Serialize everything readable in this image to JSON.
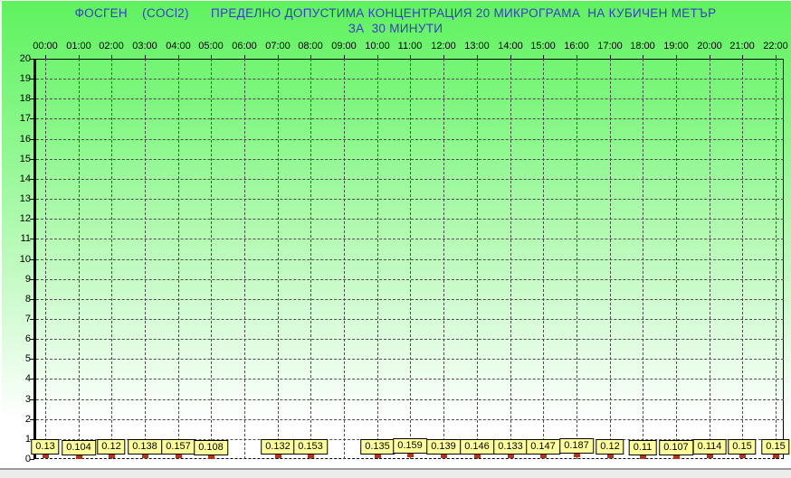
{
  "colors": {
    "background_top": "#5ef25e",
    "background_bottom": "#ffffff",
    "title_text": "#3a3acb",
    "grid": "#4d4d4d",
    "axis": "#000000",
    "marker": "#b5311a",
    "label_box_bg": "#ffff9c",
    "label_box_border": "#000000",
    "status_divider": "#9a9a9a",
    "status_bg": "#ececec"
  },
  "chart_data": {
    "type": "scatter",
    "title_line1": "ФОСГЕН    (COCl2)      ПРЕДЕЛНО ДОПУСТИМА КОНЦЕНТРАЦИЯ 20 МИКРОГРАМА  НА КУБИЧЕН МЕТЪР",
    "title_line2": "ЗА  30 МИНУТИ",
    "xlabel": "",
    "ylabel": "",
    "ylim": [
      0,
      20
    ],
    "y_ticks": [
      0,
      1,
      2,
      3,
      4,
      5,
      6,
      7,
      8,
      9,
      10,
      11,
      12,
      13,
      14,
      15,
      16,
      17,
      18,
      19,
      20
    ],
    "x_categories": [
      "00:00",
      "01:00",
      "02:00",
      "03:00",
      "04:00",
      "05:00",
      "06:00",
      "07:00",
      "08:00",
      "09:00",
      "10:00",
      "11:00",
      "12:00",
      "13:00",
      "14:00",
      "15:00",
      "16:00",
      "17:00",
      "18:00",
      "19:00",
      "20:00",
      "21:00",
      "22:00"
    ],
    "grid": true,
    "legend_position": "none",
    "points": [
      {
        "time": "00:00",
        "label": "0.13",
        "value": 0.13
      },
      {
        "time": "01:00",
        "label": "0.104",
        "value": 0.104
      },
      {
        "time": "02:00",
        "label": "0.12",
        "value": 0.12
      },
      {
        "time": "03:00",
        "label": "0.138",
        "value": 0.138
      },
      {
        "time": "04:00",
        "label": "0.157",
        "value": 0.157
      },
      {
        "time": "05:00",
        "label": "0.108",
        "value": 0.108
      },
      {
        "time": "06:00",
        "label": null,
        "value": null
      },
      {
        "time": "07:00",
        "label": "0.132",
        "value": 0.132
      },
      {
        "time": "08:00",
        "label": "0.153",
        "value": 0.153
      },
      {
        "time": "09:00",
        "label": null,
        "value": null
      },
      {
        "time": "10:00",
        "label": "0.135",
        "value": 0.135
      },
      {
        "time": "11:00",
        "label": "0.159",
        "value": 0.159
      },
      {
        "time": "12:00",
        "label": "0.139",
        "value": 0.139
      },
      {
        "time": "13:00",
        "label": "0.146",
        "value": 0.146
      },
      {
        "time": "14:00",
        "label": "0.133",
        "value": 0.133
      },
      {
        "time": "15:00",
        "label": "0.147",
        "value": 0.147
      },
      {
        "time": "16:00",
        "label": "0.187",
        "value": 0.187
      },
      {
        "time": "17:00",
        "label": "0.12",
        "value": 0.12
      },
      {
        "time": "18:00",
        "label": "0.11",
        "value": 0.11
      },
      {
        "time": "19:00",
        "label": "0.107",
        "value": 0.107
      },
      {
        "time": "20:00",
        "label": "0.114",
        "value": 0.114
      },
      {
        "time": "21:00",
        "label": "0.15",
        "value": 0.15
      },
      {
        "time": "22:00",
        "label": "0.15",
        "value": 0.15
      }
    ]
  }
}
